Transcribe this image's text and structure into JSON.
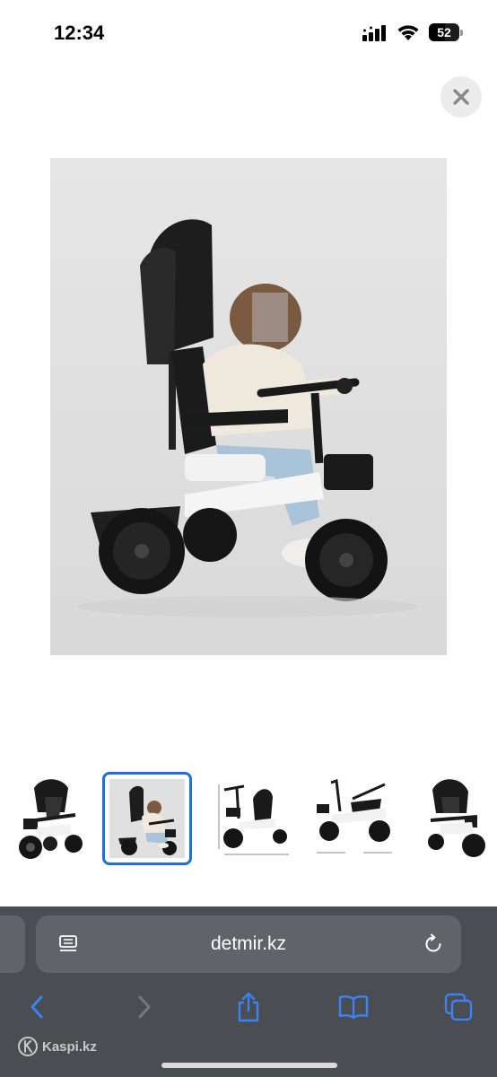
{
  "status_bar": {
    "time": "12:34",
    "battery_level": "52",
    "battery_fraction": 0.52
  },
  "gallery": {
    "selected_index": 1,
    "thumbnail_count": 5
  },
  "browser": {
    "url": "detmir.kz"
  },
  "watermark": {
    "text": "Kaspi.kz"
  },
  "colors": {
    "accent": "#1e6fd9",
    "browser_chrome": "#4a4d52",
    "address_bar": "#606368",
    "toolbar_icon": "#3b82f6"
  },
  "icons": {
    "close": "close-icon",
    "reader": "reader-mode-icon",
    "reload": "reload-icon",
    "back": "back-chevron-icon",
    "forward": "forward-chevron-icon",
    "share": "share-icon",
    "bookmarks": "bookmarks-icon",
    "tabs": "tabs-icon"
  }
}
